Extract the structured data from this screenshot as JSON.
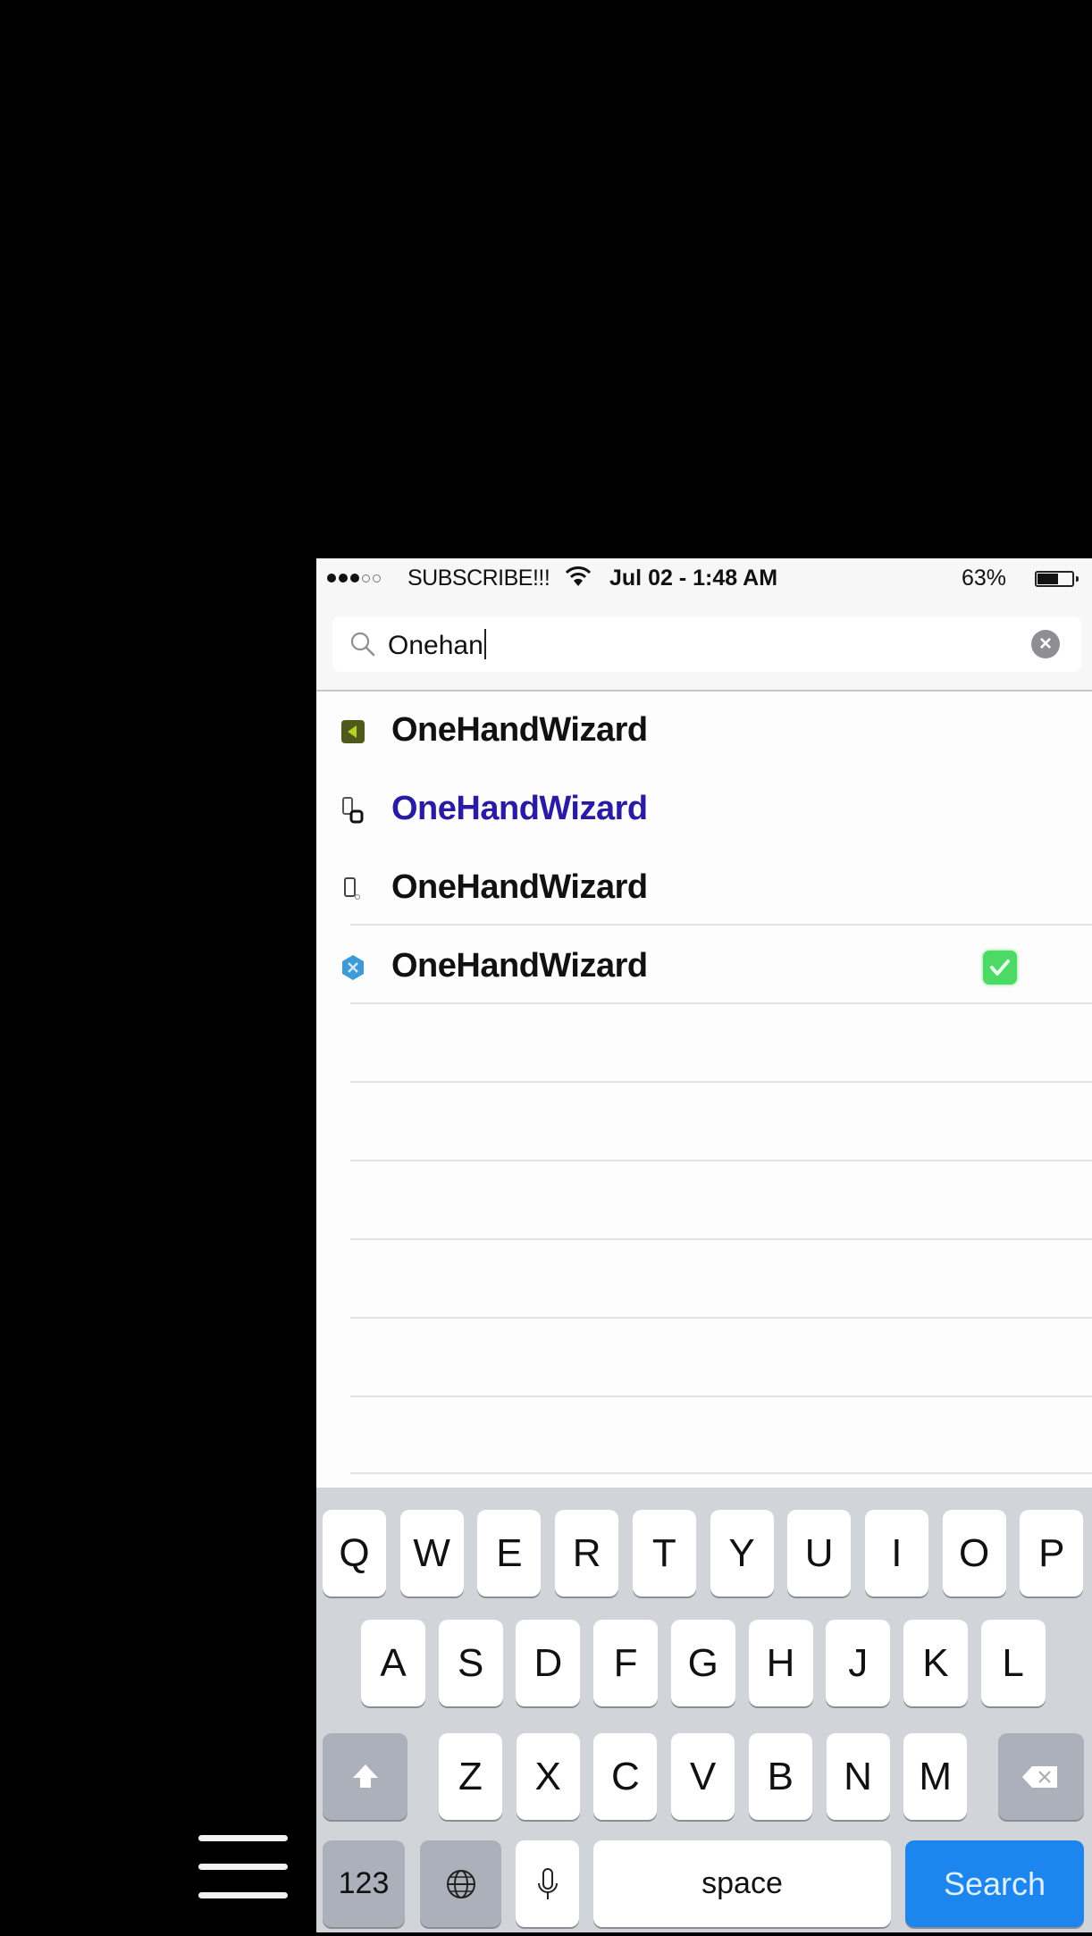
{
  "status_bar": {
    "signal_filled": 3,
    "signal_total": 5,
    "carrier": "SUBSCRIBE!!!",
    "datetime": "Jul 02 - 1:48 AM",
    "battery_percent_label": "63%",
    "battery_level": 0.63
  },
  "search": {
    "value": "Onehan",
    "icon": "magnifier-icon",
    "clear_icon": "clear-x-icon"
  },
  "results": [
    {
      "label": "OneHandWizard",
      "icon": "app-icon-green",
      "selected": false,
      "checked": false
    },
    {
      "label": "OneHandWizard",
      "icon": "phone-pair-icon",
      "selected": true,
      "checked": false
    },
    {
      "label": "OneHandWizard",
      "icon": "phone-small-icon",
      "selected": false,
      "checked": false
    },
    {
      "label": "OneHandWizard",
      "icon": "blue-hexagon-icon",
      "selected": false,
      "checked": true
    }
  ],
  "keyboard": {
    "row1": [
      "Q",
      "W",
      "E",
      "R",
      "T",
      "Y",
      "U",
      "I",
      "O",
      "P"
    ],
    "row2": [
      "A",
      "S",
      "D",
      "F",
      "G",
      "H",
      "J",
      "K",
      "L"
    ],
    "row3": [
      "Z",
      "X",
      "C",
      "V",
      "B",
      "N",
      "M"
    ],
    "numbers_label": "123",
    "space_label": "space",
    "search_label": "Search"
  },
  "colors": {
    "search_key": "#1c86ee",
    "selected_text": "#2a1ba5",
    "check_green": "#4cd964"
  }
}
